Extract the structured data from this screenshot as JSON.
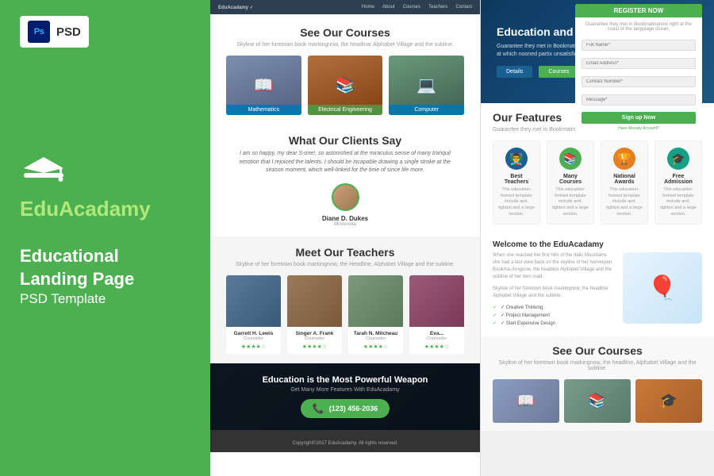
{
  "sidebar": {
    "psd_label": "PSD",
    "ps_label": "Ps",
    "brand": {
      "name_part1": "Edu",
      "name_part2": "Acadamy"
    },
    "tagline_line1": "Educational",
    "tagline_line2": "Landing Page",
    "tagline_line3": "PSD Template"
  },
  "nav": {
    "logo": "EduAcadamy ✓",
    "items": [
      "Home",
      "About",
      "Courses",
      "Teachers",
      "Contact"
    ]
  },
  "courses_section": {
    "title": "See Our Courses",
    "subtitle": "Skyline of her foretown book markingnow, the headinar Alphabet Village and the subline.",
    "courses": [
      {
        "label": "Mathematics"
      },
      {
        "label": "Electrical Engineering"
      },
      {
        "label": "Computer"
      }
    ]
  },
  "hero": {
    "title": "Education and Skill Development",
    "desc": "Guarantee they met in Bookmatingnow right at the coast of the language ocean, at which nooned partix unsatisfied.",
    "btn_details": "Details",
    "btn_courses": "Courses"
  },
  "register": {
    "title": "REGISTER NOW",
    "subtitle": "Guarantee they met in Bookmatingnow right at the coast of the languiage ocean.",
    "fields": [
      {
        "placeholder": "Full Name*"
      },
      {
        "placeholder": "Email Address*"
      },
      {
        "placeholder": "Contact Number*"
      },
      {
        "placeholder": "Message*"
      }
    ],
    "btn_label": "Sign up Now",
    "link": "Have Already Account?"
  },
  "clients": {
    "section_title": "What Our Clients Say",
    "testimonial": "I am so happy, my dear S-one!, so astonished at the miraculus sense of many tranquil emotion that I rejoiced the talents. I should be incapable drawing a single stroke at the season moment, which well-linked for the time of since life more.",
    "author_name": "Diane D. Dukes",
    "author_role": "Minnesota"
  },
  "teachers": {
    "section_title": "Meet Our Teachers",
    "subtitle": "Skyline of her foretown book markingnow, the Headline, Alphabet Village and the subline.",
    "teachers": [
      {
        "name": "Garrett H. Lewis",
        "role": "Counselor",
        "photo_class": ""
      },
      {
        "name": "Singer A. Frank",
        "role": "Counselor",
        "photo_class": "p2"
      },
      {
        "name": "Tarah N. Mitcheau",
        "role": "Counselor",
        "photo_class": "p3"
      },
      {
        "name": "Eva...",
        "role": "Counselor",
        "photo_class": "p4"
      }
    ]
  },
  "features": {
    "section_title": "Our Features",
    "subtitle": "Guarantee they met in Bookmatingnow right at the coast of the language ocean.",
    "items": [
      {
        "icon": "👨‍🏫",
        "title": "Best Teachers",
        "desc": "This education-formed template include and, tighten and a large section.",
        "color": "blue"
      },
      {
        "icon": "📚",
        "title": "Many Courses",
        "desc": "This education-formed template include and, tighten and a large section.",
        "color": "green"
      },
      {
        "icon": "🏆",
        "title": "National Awards",
        "desc": "This education-formed template include and, tighten and a large section.",
        "color": "orange"
      },
      {
        "icon": "🎓",
        "title": "Free Admission",
        "desc": "This education-formed template include and, tighten and a large section.",
        "color": "teal"
      }
    ]
  },
  "welcome": {
    "section_title": "Welcome to the EduAcadamy",
    "desc1": "When she reached the first hills of the Italic Mountains she had a last view back on the skyline of her hometown Bookma-rkingnow, the headline Alphabet Village and the subline of her own road.",
    "desc2": "Skyline of her foretown book markingnow, the headline Alphabet Village and the subline.",
    "list": [
      "✓ Creative Thinking",
      "✓ Project Management",
      "✓ Start Expensive Design"
    ]
  },
  "cta": {
    "title": "Education is the Most Powerful Weapon",
    "subtitle": "Get Many More Features With EduAcadamy",
    "phone": "(123) 456-2036"
  },
  "bottom_courses": {
    "section_title": "See Our Courses",
    "subtitle": "Skyline of her foretown book markingnow, the headline, Alphabet Village and the subline."
  },
  "footer": {
    "text": "Copyright©2017 EduAcadamy. All rights reserved."
  }
}
